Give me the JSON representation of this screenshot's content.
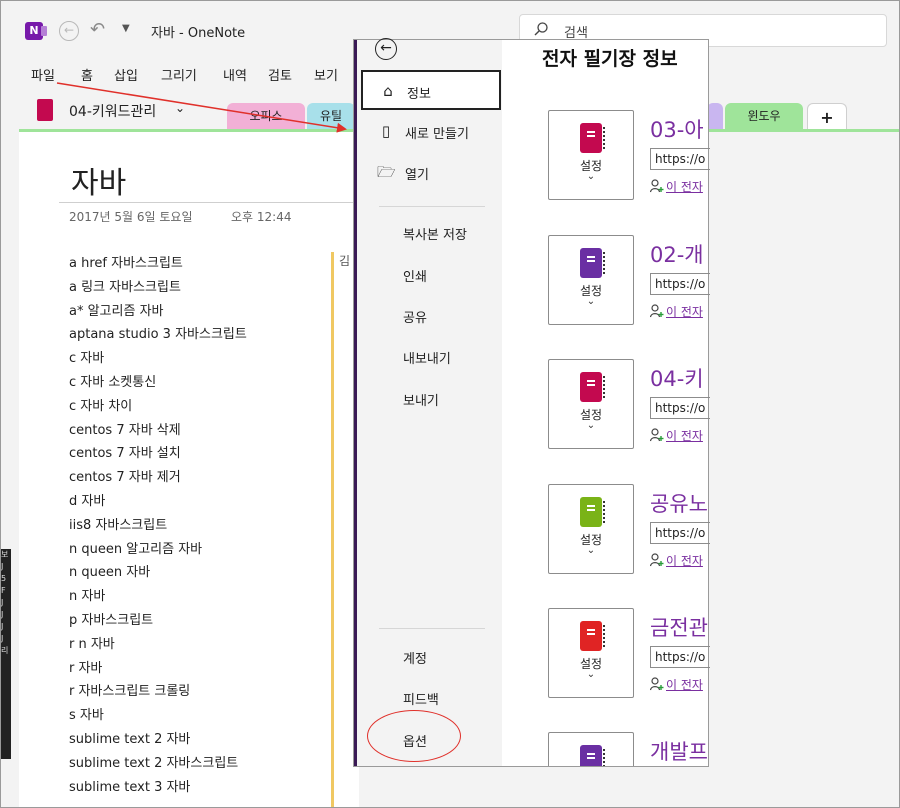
{
  "titlebar": {
    "app_logo": "N",
    "title": "자바  -  OneNote",
    "search_placeholder": "검색"
  },
  "menu": {
    "items": [
      "파일",
      "홈",
      "삽입",
      "그리기",
      "내역",
      "검토",
      "보기"
    ]
  },
  "notebook": {
    "name": "04-키워드관리",
    "sections": [
      {
        "label": "오피스",
        "color": "#f2b0d6"
      },
      {
        "label": "유틸",
        "color": "#a8e0ea"
      },
      {
        "label": "윈도우",
        "color": "#9fe49a"
      }
    ],
    "add_section": "+"
  },
  "page": {
    "title": "자바",
    "date": "2017년 5월 6일 토요일",
    "time": "오후 12:44",
    "column_char": "김",
    "keywords": [
      "a href 자바스크립트",
      "a 링크 자바스크립트",
      "a* 알고리즘 자바",
      "aptana studio 3 자바스크립트",
      "c 자바",
      "c 자바 소켓통신",
      "c 자바 차이",
      "centos 7 자바 삭제",
      "centos 7 자바 설치",
      "centos 7 자바 제거",
      "d 자바",
      "iis8 자바스크립트",
      "n queen 알고리즘 자바",
      "n queen 자바",
      "n 자바",
      "p 자바스크립트",
      "r n 자바",
      "r 자바",
      "r 자바스크립트 크롤링",
      "s 자바",
      "sublime text 2 자바",
      "sublime text 2 자바스크립트",
      "sublime text 3 자바"
    ]
  },
  "left_strip_text": "보\nJ\n5\nF\nJ\nJ\nJ\nJ\n리\n",
  "backstage": {
    "heading": "전자 필기장 정보",
    "nav": {
      "info": "정보",
      "new": "새로 만들기",
      "open": "열기",
      "save_copy": "복사본 저장",
      "print": "인쇄",
      "share": "공유",
      "export": "내보내기",
      "send": "보내기",
      "account": "계정",
      "feedback": "피드백",
      "options": "옵션"
    },
    "settings_label": "설정",
    "url_text": "https://o",
    "share_text": "이 전자",
    "notebooks": [
      {
        "title": "03-아",
        "color": "#c3094f"
      },
      {
        "title": "02-개",
        "color": "#6a2fa3"
      },
      {
        "title": "04-키",
        "color": "#c3094f"
      },
      {
        "title": "공유노",
        "color": "#7ab317"
      },
      {
        "title": "금전관",
        "color": "#e02424"
      },
      {
        "title": "개발프",
        "color": "#6a2fa3"
      }
    ]
  },
  "colors": {
    "onenote_purple": "#7719aa",
    "annotation_red": "#e0302a",
    "link_purple": "#7a2fa0"
  },
  "icons": [
    "onenote-logo-icon",
    "back-icon",
    "undo-icon",
    "dropdown-icon",
    "search-icon",
    "notebook-icon",
    "home-icon",
    "new-notebook-icon",
    "folder-icon",
    "person-add-icon"
  ]
}
